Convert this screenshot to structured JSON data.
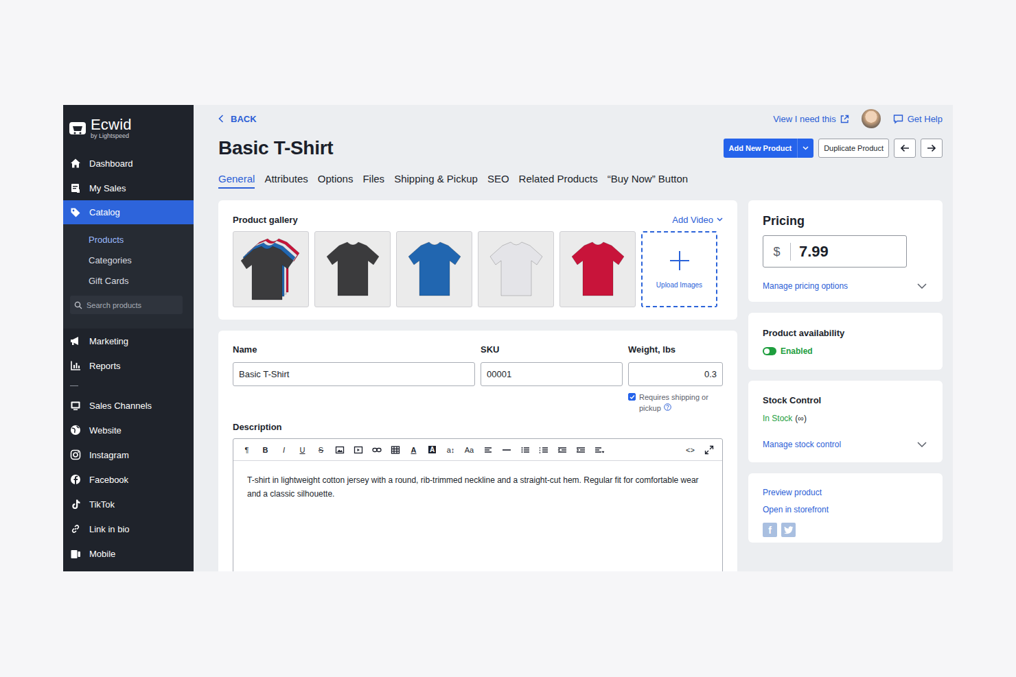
{
  "app": {
    "logo": "Ecwid",
    "tagline": "by Lightspeed"
  },
  "sidebar": {
    "items": [
      {
        "label": "Dashboard",
        "selected": false
      },
      {
        "label": "My Sales",
        "selected": false
      },
      {
        "label": "Catalog",
        "selected": true
      }
    ],
    "subitems": [
      {
        "label": "Products",
        "selected": true
      },
      {
        "label": "Categories",
        "selected": false
      },
      {
        "label": "Gift Cards",
        "selected": false
      }
    ],
    "search": {
      "placeholder": "Search products"
    },
    "tools": [
      {
        "label": "Marketing",
        "selected": false
      },
      {
        "label": "Reports",
        "selected": false
      }
    ],
    "channels": [
      {
        "label": "Sales Channels",
        "selected": false
      },
      {
        "label": "Website",
        "selected": false
      },
      {
        "label": "Instagram",
        "selected": false
      },
      {
        "label": "Facebook",
        "selected": false
      },
      {
        "label": "TikTok",
        "selected": false
      },
      {
        "label": "Link in bio",
        "selected": false
      },
      {
        "label": "Mobile",
        "selected": false
      }
    ]
  },
  "header": {
    "back": "BACK",
    "title": "Basic T-Shirt",
    "links": [
      "View I need this",
      "Get Help"
    ],
    "buttons": [
      {
        "label": "Add New Product",
        "kind": "primary"
      },
      {
        "label": "Duplicate Product",
        "kind": "secondary"
      }
    ]
  },
  "tabs": [
    {
      "label": "General",
      "selected": true
    },
    {
      "label": "Attributes",
      "selected": false
    },
    {
      "label": "Options",
      "selected": false
    },
    {
      "label": "Files",
      "selected": false
    },
    {
      "label": "Shipping & Pickup",
      "selected": false
    },
    {
      "label": "SEO",
      "selected": false
    },
    {
      "label": "Related Products",
      "selected": false
    },
    {
      "label": "“Buy Now” Button",
      "selected": false
    }
  ],
  "gallery": {
    "title": "Product gallery",
    "add_video": "Add Video",
    "upload": "Upload Images",
    "images": [
      {
        "kind": "stack",
        "color": "#3b3b3d",
        "layers": [
          "#c8143a",
          "#e4e4e8",
          "#2166b0"
        ]
      },
      {
        "kind": "single",
        "color": "#3b3b3d"
      },
      {
        "kind": "single",
        "color": "#2166b0"
      },
      {
        "kind": "single",
        "color": "#e4e4e8"
      },
      {
        "kind": "single",
        "color": "#c8143a"
      }
    ]
  },
  "form": {
    "fields": [
      {
        "label": "Name",
        "value": "Basic T-Shirt"
      },
      {
        "label": "SKU",
        "value": "00001"
      },
      {
        "label": "Weight, lbs",
        "value": "0.3"
      }
    ],
    "shipping": {
      "label": "Requires shipping or pickup",
      "checked": true
    },
    "description": {
      "label": "Description",
      "toolbar_left": [
        {
          "kind": "glyph",
          "text": "¶"
        },
        {
          "kind": "bold",
          "text": "B"
        },
        {
          "kind": "italic",
          "text": "I"
        },
        {
          "kind": "underline",
          "text": "U"
        },
        {
          "kind": "strike",
          "text": "S"
        },
        {
          "kind": "icon"
        },
        {
          "kind": "icon"
        },
        {
          "kind": "icon"
        },
        {
          "kind": "icon"
        },
        {
          "kind": "uline",
          "text": "A"
        },
        {
          "kind": "boxed",
          "text": "A"
        },
        {
          "kind": "glyph",
          "text": "a↕"
        },
        {
          "kind": "glyph",
          "text": "Aa"
        },
        {
          "kind": "icon"
        },
        {
          "kind": "icon"
        },
        {
          "kind": "icon"
        },
        {
          "kind": "icon"
        },
        {
          "kind": "icon"
        },
        {
          "kind": "icon"
        },
        {
          "kind": "icon"
        }
      ],
      "toolbar_right": [
        {
          "kind": "glyph",
          "text": "<>"
        },
        {
          "kind": "icon"
        }
      ],
      "text": "T-shirt in lightweight cotton jersey with a round, rib-trimmed neckline and a straight-cut hem. Regular fit for comfortable wear and a classic silhouette."
    }
  },
  "pricing": {
    "title": "Pricing",
    "currency": "$",
    "price": "7.99",
    "manage": "Manage pricing options",
    "expanded": false
  },
  "availability": {
    "title": "Product availability",
    "status": "Enabled",
    "on": true
  },
  "stock": {
    "title": "Stock Control",
    "status": "In Stock",
    "quantity": "(∞)",
    "manage": "Manage stock control",
    "expanded": false
  },
  "links": [
    "Preview product",
    "Open in storefront"
  ],
  "share": {
    "facebook": "f"
  }
}
